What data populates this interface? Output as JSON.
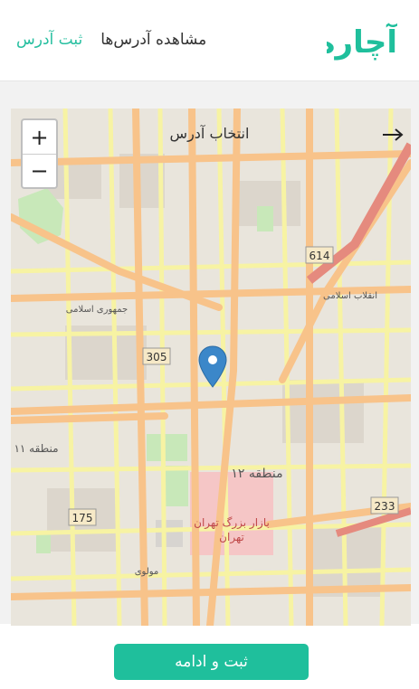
{
  "header": {
    "logo_text": "آچاره",
    "nav": [
      {
        "label": "ثبت آدرس",
        "active": true
      },
      {
        "label": "مشاهده آدرس‌ها",
        "active": false
      }
    ]
  },
  "map": {
    "title": "انتخاب آدرس",
    "zoom_in": "+",
    "zoom_out": "−",
    "labels": {
      "region_12": "منطقه ۱۲",
      "region_11": "منطقه ۱۱",
      "bazaar": "بازار بزرگ تهران",
      "tehran": "تهران",
      "road_614": "614",
      "road_305": "305",
      "road_175": "175",
      "road_233": "233",
      "enghelab": "انقلاب اسلامی",
      "molavi": "مولوی",
      "jomhouri": "جمهوری اسلامی"
    }
  },
  "footer": {
    "submit_label": "ثبت و ادامه"
  },
  "colors": {
    "accent": "#1fbf9c",
    "nav_active": "#27bfa0",
    "road_major": "#f8c38a",
    "road_secondary": "#f7f3a3",
    "bazaar_area": "#f5c6c6",
    "park": "#c8e8b9",
    "pin": "#3b87c9"
  }
}
